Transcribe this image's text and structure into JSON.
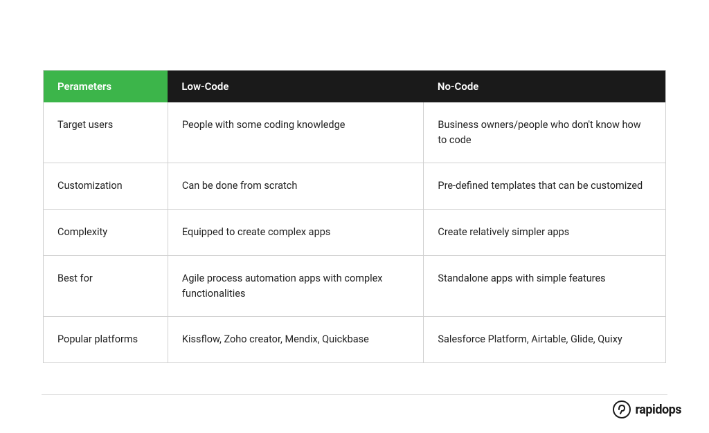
{
  "table": {
    "headers": {
      "parameters": "Perameters",
      "lowcode": "Low-Code",
      "nocode": "No-Code"
    },
    "rows": [
      {
        "param": "Target users",
        "lowcode": "People with some coding knowledge",
        "nocode": "Business owners/people who don't know how to code"
      },
      {
        "param": "Customization",
        "lowcode": "Can be done from scratch",
        "nocode": "Pre-defined templates that can be customized"
      },
      {
        "param": "Complexity",
        "lowcode": "Equipped to create complex apps",
        "nocode": "Create relatively simpler apps"
      },
      {
        "param": "Best for",
        "lowcode": "Agile process automation apps with complex functionalities",
        "nocode": "Standalone apps with simple features"
      },
      {
        "param": "Popular platforms",
        "lowcode": "Kissflow, Zoho creator, Mendix, Quickbase",
        "nocode": "Salesforce Platform, Airtable, Glide, Quixy"
      }
    ]
  },
  "footer": {
    "brand": "rapidops"
  }
}
